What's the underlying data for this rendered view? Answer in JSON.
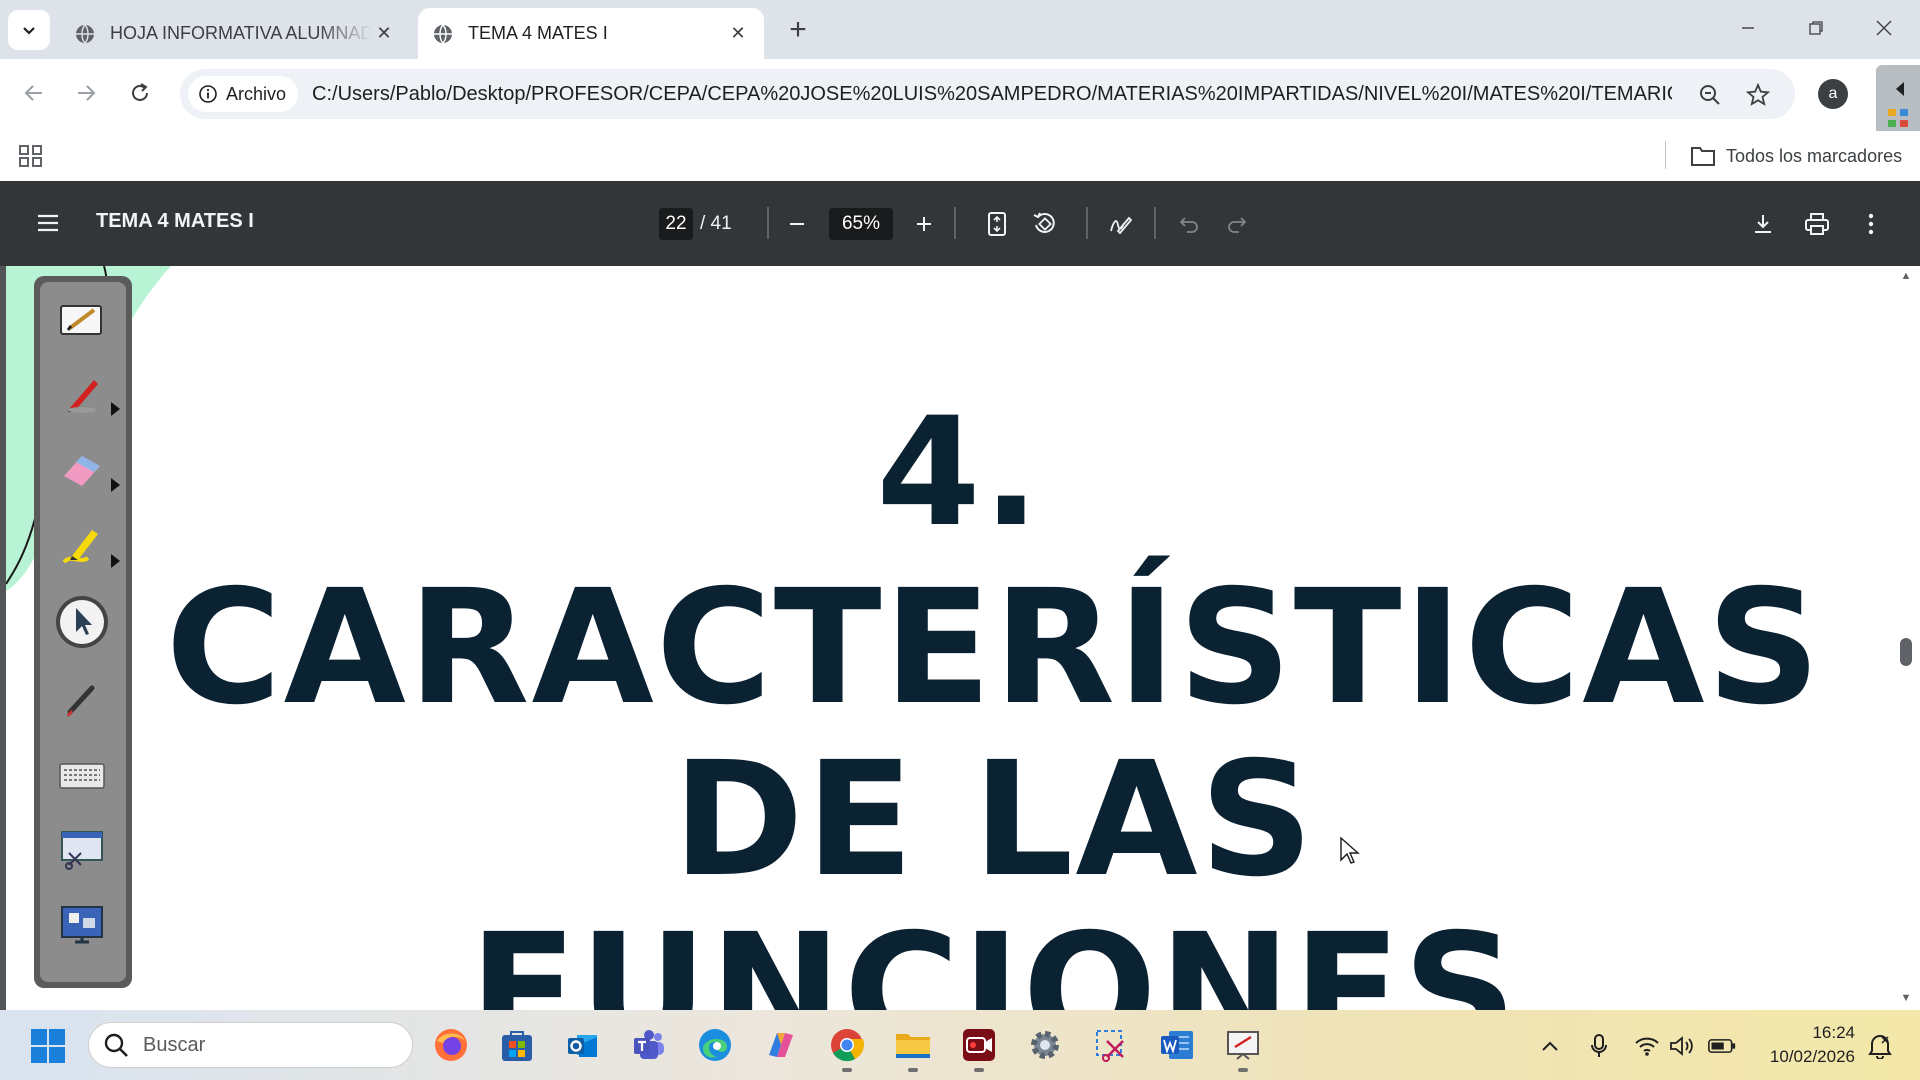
{
  "browser": {
    "tabs": [
      {
        "title": "HOJA INFORMATIVA ALUMNADO",
        "active": false
      },
      {
        "title": "TEMA 4 MATES I",
        "active": true
      }
    ],
    "site_chip": "Archivo",
    "url": "C:/Users/Pablo/Desktop/PROFESOR/CEPA/CEPA%20JOSE%20LUIS%20SAMPEDRO/MATERIAS%20IMPARTIDAS/NIVEL%20I/MATES%20I/TEMARIO/...",
    "avatar_letter": "a",
    "bookmarks_all": "Todos los marcadores"
  },
  "pdf": {
    "title": "TEMA 4 MATES I",
    "current_page": "22",
    "total_pages": "/ 41",
    "zoom": "65%"
  },
  "document": {
    "heading_lines": [
      "4.",
      "CARACTERÍSTICAS",
      "DE LAS",
      "FUNCIONES"
    ]
  },
  "taskbar": {
    "search_placeholder": "Buscar",
    "time": "16:24",
    "date": "10/02/2026"
  },
  "colors": {
    "pdf_toolbar": "#323639",
    "heading_text": "#0b2233",
    "tab_strip": "#dee3ea"
  },
  "icons": [
    "chevron-down-icon",
    "globe-icon",
    "close-icon",
    "plus-icon",
    "back-icon",
    "forward-icon",
    "reload-icon",
    "info-icon",
    "zoom-icon",
    "star-icon",
    "apps-grid-icon",
    "folder-icon",
    "menu-icon",
    "minus-icon",
    "fit-page-icon",
    "rotate-icon",
    "annotate-icon",
    "undo-icon",
    "redo-icon",
    "download-icon",
    "print-icon",
    "more-icon"
  ]
}
